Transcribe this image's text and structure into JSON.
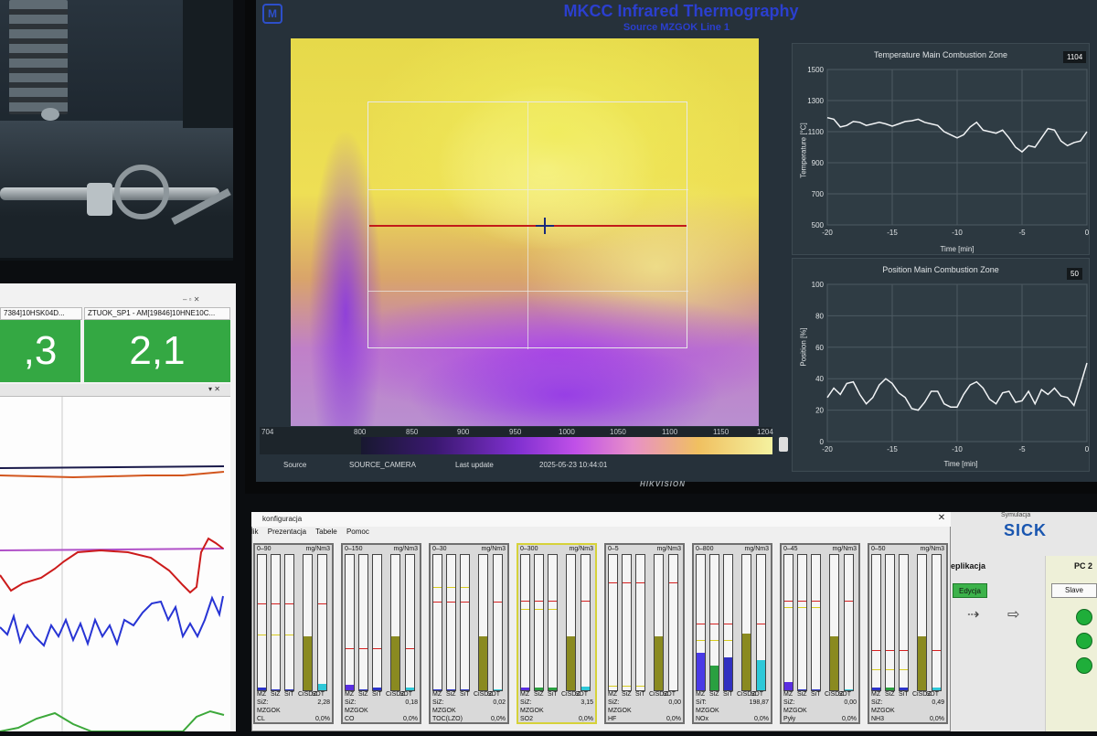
{
  "main_monitor": {
    "logo": "M",
    "title": "MKCC Infrared Thermography",
    "subtitle": "Source MZGOK Line 1",
    "scale_min": "704",
    "scale_ticks": [
      "800",
      "850",
      "900",
      "950",
      "1000",
      "1050",
      "1100",
      "1150"
    ],
    "scale_max": "1204",
    "source_label": "Source",
    "source_value": "SOURCE_CAMERA",
    "last_update_label": "Last update",
    "last_update_value": "2025-05-23 10:44:01",
    "brand": "HIKVISION"
  },
  "temp_chart": {
    "title": "Temperature Main Combustion Zone",
    "current_value": "1104",
    "ylabel": "Temperature [°C]",
    "xlabel": "Time [min]",
    "y_ticks": [
      "1500",
      "1300",
      "1100",
      "900",
      "700",
      "500"
    ],
    "x_ticks": [
      "-20",
      "-15",
      "-10",
      "-5",
      "0"
    ]
  },
  "pos_chart": {
    "title": "Position Main Combustion Zone",
    "current_value": "50",
    "ylabel": "Position [%]",
    "xlabel": "Time [min]",
    "y_ticks": [
      "100",
      "80",
      "60",
      "40",
      "20",
      "0"
    ],
    "x_ticks": [
      "-20",
      "-15",
      "-10",
      "-5",
      "0"
    ]
  },
  "chart_data": [
    {
      "type": "line",
      "title": "Temperature Main Combustion Zone",
      "xlabel": "Time [min]",
      "ylabel": "Temperature [°C]",
      "xlim": [
        -20,
        0
      ],
      "ylim": [
        500,
        1500
      ],
      "grid": true,
      "series": [
        {
          "x": [
            -20,
            -19.5,
            -19,
            -18.5,
            -18,
            -17.5,
            -17,
            -16.5,
            -16,
            -15.5,
            -15,
            -14.5,
            -14,
            -13.5,
            -13,
            -12.5,
            -12,
            -11.5,
            -11,
            -10.5,
            -10,
            -9.5,
            -9,
            -8.5,
            -8,
            -7.5,
            -7,
            -6.5,
            -6,
            -5.5,
            -5,
            -4.5,
            -4,
            -3.5,
            -3,
            -2.5,
            -2,
            -1.5,
            -1,
            -0.5,
            0
          ],
          "values": [
            1190,
            1180,
            1130,
            1140,
            1165,
            1160,
            1140,
            1150,
            1160,
            1150,
            1135,
            1150,
            1165,
            1170,
            1180,
            1160,
            1150,
            1140,
            1100,
            1080,
            1060,
            1080,
            1130,
            1160,
            1110,
            1100,
            1090,
            1110,
            1060,
            1000,
            970,
            1010,
            1000,
            1060,
            1120,
            1110,
            1040,
            1010,
            1030,
            1040,
            1100
          ]
        }
      ]
    },
    {
      "type": "line",
      "title": "Position Main Combustion Zone",
      "xlabel": "Time [min]",
      "ylabel": "Position [%]",
      "xlim": [
        -20,
        0
      ],
      "ylim": [
        0,
        100
      ],
      "grid": true,
      "series": [
        {
          "x": [
            -20,
            -19.5,
            -19,
            -18.5,
            -18,
            -17.5,
            -17,
            -16.5,
            -16,
            -15.5,
            -15,
            -14.5,
            -14,
            -13.5,
            -13,
            -12.5,
            -12,
            -11.5,
            -11,
            -10.5,
            -10,
            -9.5,
            -9,
            -8.5,
            -8,
            -7.5,
            -7,
            -6.5,
            -6,
            -5.5,
            -5,
            -4.5,
            -4,
            -3.5,
            -3,
            -2.5,
            -2,
            -1.5,
            -1,
            -0.5,
            0
          ],
          "values": [
            28,
            34,
            30,
            37,
            38,
            30,
            24,
            28,
            36,
            40,
            37,
            31,
            28,
            21,
            20,
            25,
            32,
            32,
            24,
            22,
            22,
            30,
            36,
            38,
            34,
            27,
            24,
            31,
            32,
            25,
            26,
            32,
            24,
            33,
            30,
            34,
            29,
            28,
            23,
            36,
            50
          ]
        }
      ]
    }
  ],
  "left_panel": {
    "tile1_header": "7384]10HSK04D...",
    "tile1_value": ",3",
    "tile2_header": "ZTUOK_SP1 - AM[19846]10HNE10C...",
    "tile2_value": "2,1",
    "window_btns": "– ▫ ✕"
  },
  "konfiguracja": {
    "title": "konfiguracja",
    "close": "✕",
    "menu": [
      "lik",
      "Prezentacja",
      "Tabele",
      "Pomoc"
    ],
    "bar_labels": [
      "MZ",
      "SiZ",
      "SiT",
      "CiSDZ",
      "SDT"
    ],
    "gauges": [
      {
        "range": "0–90",
        "unit": "mg/Nm3",
        "row1": "SiZ:",
        "val1": "2,28",
        "row2": "MZGOK",
        "name": "CL",
        "pct": "0,0%",
        "fills": [
          0.02,
          0.01,
          0.01,
          0.4,
          0.05
        ],
        "red": 0.65,
        "yellow": 0.42,
        "colors": [
          "#2a32c8",
          "#2a32c8",
          "#2a32c8",
          "#8a8a20",
          "#2ec8d8"
        ]
      },
      {
        "range": "0–150",
        "unit": "mg/Nm3",
        "row1": "SiZ:",
        "val1": "0,18",
        "row2": "MZGOK",
        "name": "CO",
        "pct": "0,0%",
        "fills": [
          0.04,
          0.01,
          0.02,
          0.4,
          0.02
        ],
        "red": 0.32,
        "yellow": 0.0,
        "colors": [
          "#5a2ee0",
          "#2a32c8",
          "#2a32c8",
          "#8a8a20",
          "#2ec8d8"
        ]
      },
      {
        "range": "0–30",
        "unit": "mg/Nm3",
        "row1": "SiZ:",
        "val1": "0,02",
        "row2": "MZGOK",
        "name": "TOC(LZO)",
        "pct": "0,0%",
        "fills": [
          0.01,
          0.01,
          0.01,
          0.4,
          0.01
        ],
        "red": 0.66,
        "yellow": 0.77,
        "colors": [
          "#2a32c8",
          "#2a32c8",
          "#2a32c8",
          "#8a8a20",
          "#2ec8d8"
        ]
      },
      {
        "range": "0–300",
        "unit": "mg/Nm3",
        "row1": "SiZ:",
        "val1": "3,15",
        "row2": "MZGOK",
        "name": "SO2",
        "pct": "0,0%",
        "fills": [
          0.02,
          0.02,
          0.02,
          0.4,
          0.03
        ],
        "red": 0.67,
        "yellow": 0.61,
        "colors": [
          "#5a2ee0",
          "#2aa040",
          "#2aa040",
          "#8a8a20",
          "#2ec8d8"
        ]
      },
      {
        "range": "0–5",
        "unit": "mg/Nm3",
        "row1": "SiZ:",
        "val1": "0,00",
        "row2": "MZGOK",
        "name": "HF",
        "pct": "0,0%",
        "fills": [
          0,
          0,
          0,
          0.4,
          0
        ],
        "red": 0.8,
        "yellow": 0.05,
        "colors": [
          "#2a32c8",
          "#2a32c8",
          "#2a32c8",
          "#8a8a20",
          "#2ec8d8"
        ]
      },
      {
        "range": "0–800",
        "unit": "mg/Nm3",
        "row1": "SiT:",
        "val1": "198,87",
        "row2": "MZGOK",
        "name": "NOx",
        "pct": "0,0%",
        "fills": [
          0.28,
          0.18,
          0.24,
          0.42,
          0.22
        ],
        "red": 0.5,
        "yellow": 0.38,
        "colors": [
          "#4a3ae6",
          "#2aa040",
          "#3030c0",
          "#8a8a20",
          "#2ec8d8"
        ]
      },
      {
        "range": "0–45",
        "unit": "mg/Nm3",
        "row1": "SiZ:",
        "val1": "0,00",
        "row2": "MZGOK",
        "name": "Pyły",
        "pct": "0,0%",
        "fills": [
          0.06,
          0.01,
          0.01,
          0.4,
          0.01
        ],
        "red": 0.67,
        "yellow": 0.62,
        "colors": [
          "#5a2ee0",
          "#2a32c8",
          "#2a32c8",
          "#8a8a20",
          "#2ec8d8"
        ]
      },
      {
        "range": "0–50",
        "unit": "mg/Nm3",
        "row1": "SiZ:",
        "val1": "0,49",
        "row2": "MZGOK",
        "name": "NH3",
        "pct": "0,0%",
        "fills": [
          0.02,
          0.02,
          0.02,
          0.4,
          0.02
        ],
        "red": 0.31,
        "yellow": 0.17,
        "colors": [
          "#2a32c8",
          "#2aa040",
          "#2a32c8",
          "#8a8a20",
          "#2ec8d8"
        ]
      }
    ]
  },
  "sick_panel": {
    "symulacja": "Symulacja",
    "logo": "SICK",
    "replikacja": "eplikacja",
    "edycja": "Edycja",
    "pc2": "PC 2",
    "slave": "Slave"
  }
}
